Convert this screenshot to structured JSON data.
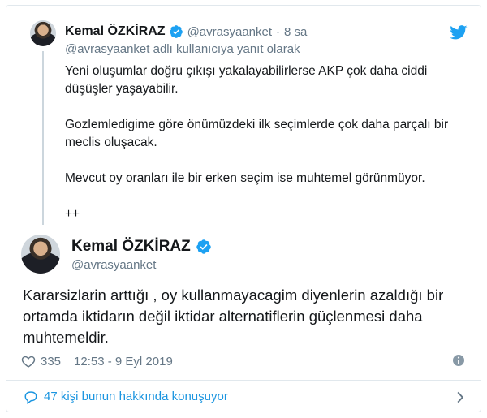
{
  "parent_tweet": {
    "author_name": "Kemal ÖZKİRAZ",
    "handle": "@avrasyaanket",
    "separator": "·",
    "time": "8 sa",
    "reply_context": "@avrasyaanket adlı kullanıcıya yanıt olarak",
    "paragraphs": [
      "Yeni oluşumlar doğru çıkışı yakalayabilirlerse AKP çok daha ciddi düşüşler yaşayabilir.",
      "Gozlemledigime göre önümüzdeki ilk seçimlerde çok daha parçalı bir meclis oluşacak.",
      "Mevcut oy oranları ile bir erken seçim ise muhtemel görünmüyor.",
      "++"
    ]
  },
  "main_tweet": {
    "author_name": "Kemal ÖZKİRAZ",
    "handle": "@avrasyaanket",
    "text": "Kararsizlarin arttığı , oy kullanmayacagim diyenlerin azaldığı bir ortamda iktidarın değil iktidar alternatiflerin güçlenmesi daha muhtemeldir.",
    "like_count": "335",
    "timestamp": "12:53 - 9 Eyl 2019"
  },
  "conversation": {
    "label": "47 kişi bunun hakkında konuşuyor"
  },
  "colors": {
    "brand_blue": "#1da1f2",
    "link_blue": "#1b95e0",
    "muted_gray": "#657786",
    "border": "#e1e8ed"
  },
  "icons": [
    "verified-badge-icon",
    "twitter-bird-icon",
    "heart-icon",
    "info-icon",
    "comment-bubble-icon",
    "chevron-right-icon"
  ]
}
